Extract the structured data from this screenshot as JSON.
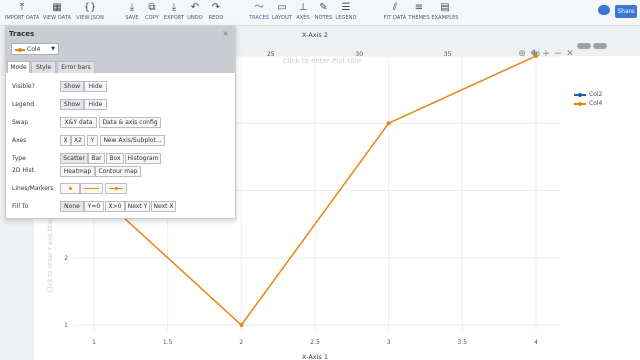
{
  "toolbar": {
    "items": [
      {
        "label": "IMPORT DATA",
        "icon": "upload-icon"
      },
      {
        "label": "VIEW DATA",
        "icon": "grid-icon"
      },
      {
        "label": "VIEW JSON",
        "icon": "braces-icon"
      },
      {
        "label": "SAVE",
        "icon": "save-icon"
      },
      {
        "label": "COPY",
        "icon": "copy-icon"
      },
      {
        "label": "EXPORT",
        "icon": "download-icon"
      },
      {
        "label": "UNDO",
        "icon": "undo-icon"
      },
      {
        "label": "REDO",
        "icon": "redo-icon"
      },
      {
        "label": "TRACES",
        "icon": "traces-icon",
        "active": true
      },
      {
        "label": "LAYOUT",
        "icon": "layout-icon"
      },
      {
        "label": "AXES",
        "icon": "axes-icon"
      },
      {
        "label": "NOTES",
        "icon": "notes-icon"
      },
      {
        "label": "LEGEND",
        "icon": "legend-icon"
      },
      {
        "label": "FIT DATA",
        "icon": "fit-icon"
      },
      {
        "label": "THEMES",
        "icon": "themes-icon"
      },
      {
        "label": "EXAMPLES",
        "icon": "examples-icon"
      }
    ],
    "share_label": "Share"
  },
  "panel": {
    "title": "Traces",
    "close_glyph": "×",
    "selected_trace": "Col4",
    "tabs": [
      "Mode",
      "Style",
      "Error bars"
    ],
    "rows": {
      "visible": {
        "label": "Visible?",
        "options": [
          "Show",
          "Hide"
        ]
      },
      "legend": {
        "label": "Legend",
        "options": [
          "Show",
          "Hide"
        ]
      },
      "swap": {
        "label": "Swap",
        "options": [
          "X&Y data",
          "Data & axis config"
        ]
      },
      "axes": {
        "label": "Axes",
        "options": [
          "X",
          "X2",
          "Y",
          "New Axis/Subplot..."
        ]
      },
      "type": {
        "label": "Type",
        "options": [
          "Scatter",
          "Bar",
          "Box",
          "Histogram"
        ]
      },
      "hist2d": {
        "label": "2D Hist.",
        "options": [
          "Heatmap",
          "Contour map"
        ]
      },
      "lines_markers": {
        "label": "Lines/Markers"
      },
      "fill_to": {
        "label": "Fill To",
        "options": [
          "None",
          "Y=0",
          "X>0",
          "Next Y",
          "Next X"
        ]
      }
    }
  },
  "chart_data": {
    "type": "line",
    "title_placeholder": "Click to enter Plot title",
    "xlabel": "X-Axis 1",
    "x2label": "X-Axis 2",
    "ylabel": "Click to enter Y axis title",
    "x_ticks": [
      "1",
      "1.5",
      "2",
      "2.5",
      "3",
      "3.5",
      "4"
    ],
    "x2_ticks": [
      "20",
      "25",
      "30",
      "35",
      "40"
    ],
    "y_ticks": [
      "1",
      "2",
      "3"
    ],
    "series": [
      {
        "name": "Col2",
        "color": "#1f5fa8",
        "x": [],
        "y": []
      },
      {
        "name": "Col4",
        "color": "#e8840f",
        "x": [
          1,
          2,
          3,
          4
        ],
        "y": [
          3,
          1,
          4,
          5
        ]
      }
    ],
    "grid": true,
    "legend_position": "top-right"
  }
}
